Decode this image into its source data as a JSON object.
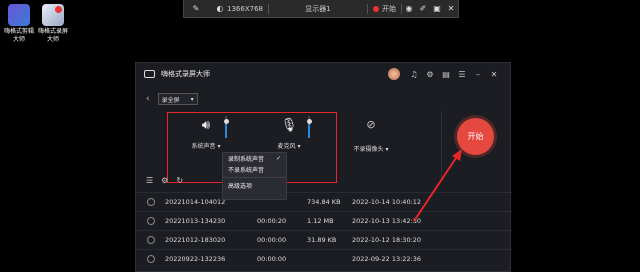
{
  "desktop": {
    "icons": [
      {
        "label": "嗨格式剪辑大师",
        "icon": "video-editor-icon"
      },
      {
        "label": "嗨格式录屏大师",
        "icon": "screen-recorder-icon"
      }
    ]
  },
  "topbar": {
    "resolution": "1366X768",
    "display": "显示器1",
    "record_label": "开始"
  },
  "window": {
    "title": "嗨格式录屏大师",
    "mode": "录全屏",
    "system_audio_label": "系统声音",
    "mic_label": "麦克风",
    "camera_label": "不录摄像头",
    "start_label": "开始"
  },
  "dropdown": {
    "items": [
      "录制系统声音",
      "不录系统声音",
      "高级选项"
    ]
  },
  "recordings": [
    {
      "name": "20221014-104012",
      "duration": "",
      "size": "734.84 KB",
      "date": "2022-10-14 10:40:12"
    },
    {
      "name": "20221013-134230",
      "duration": "00:00:20",
      "size": "1.12 MB",
      "date": "2022-10-13 13:42:30"
    },
    {
      "name": "20221012-183020",
      "duration": "00:00:00",
      "size": "31.89 KB",
      "date": "2022-10-12 18:30:20"
    },
    {
      "name": "20220922-132236",
      "duration": "00:00:00",
      "size": "",
      "date": "2022-09-22 13:22:36"
    }
  ],
  "colors": {
    "accent_red": "#e5483e",
    "highlight": "#e8262b",
    "slider": "#2b8ad8"
  }
}
